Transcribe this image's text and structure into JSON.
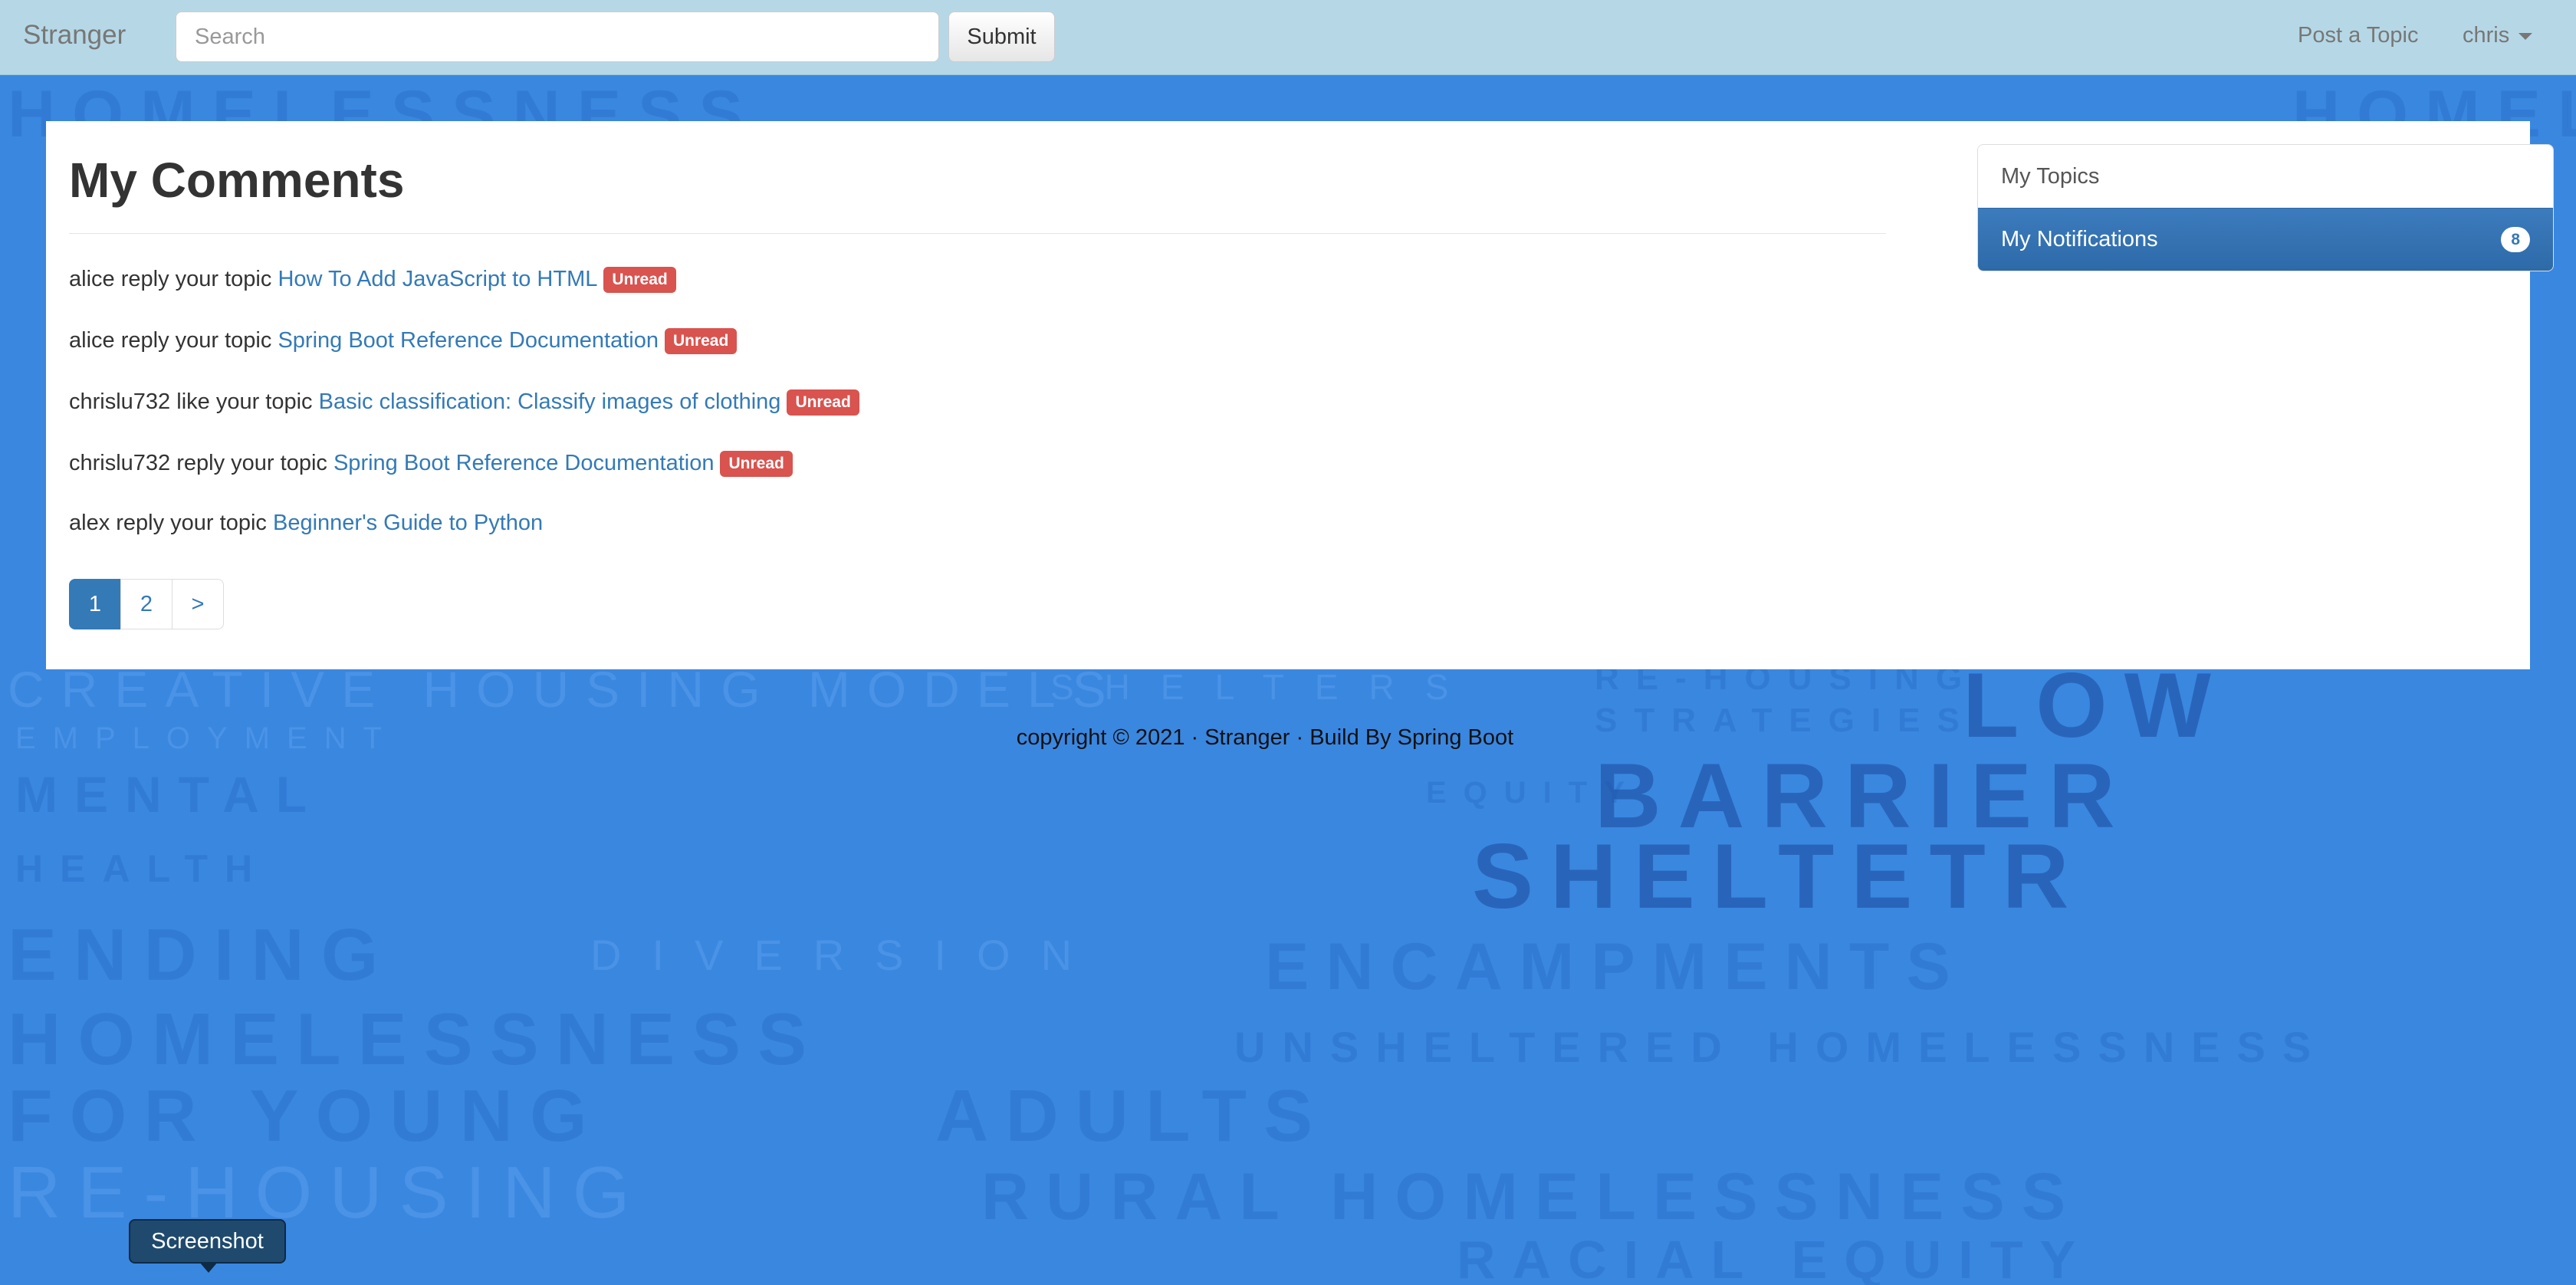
{
  "navbar": {
    "brand": "Stranger",
    "search_placeholder": "Search",
    "submit_label": "Submit",
    "post_topic_label": "Post a Topic",
    "user_label": "chris"
  },
  "main": {
    "title": "My Comments",
    "comments": [
      {
        "actor": "alice",
        "action": "reply your topic",
        "topic": "How To Add JavaScript to HTML",
        "badge": "Unread"
      },
      {
        "actor": "alice",
        "action": "reply your topic",
        "topic": "Spring Boot Reference Documentation",
        "badge": "Unread"
      },
      {
        "actor": "chrislu732",
        "action": "like your topic",
        "topic": "Basic classification: Classify images of clothing",
        "badge": "Unread"
      },
      {
        "actor": "chrislu732",
        "action": "reply your topic",
        "topic": "Spring Boot Reference Documentation",
        "badge": "Unread"
      },
      {
        "actor": "alex",
        "action": "reply your topic",
        "topic": "Beginner's Guide to Python",
        "badge": ""
      }
    ],
    "pagination": [
      "1",
      "2",
      ">"
    ]
  },
  "sidebar": {
    "items": [
      {
        "label": "My Topics",
        "badge": ""
      },
      {
        "label": "My Notifications",
        "badge": "8"
      }
    ]
  },
  "footer": {
    "text": "copyright © 2021 · Stranger · Build By Spring Boot"
  },
  "tooltip": {
    "label": "Screenshot"
  },
  "background_words": [
    "HOMELESSNESS",
    "CREATIVE HOUSING MODELS",
    "SHELTERS",
    "RE-HOUSING",
    "STRATEGIES",
    "LOW",
    "EMPLOYMENT",
    "BARRIER",
    "EQUITY",
    "MENTAL",
    "HEALTH",
    "SHELTETR",
    "ENDING",
    "DIVERSION",
    "ENCAMPMENTS",
    "UNSHELTERED HOMELESSNESS",
    "FOR YOUNG",
    "ADULTS",
    "RURAL HOMELESSNESS",
    "RACIAL EQUITY"
  ],
  "colors": {
    "navbar": "#b6d8e6",
    "page_background": "#3a87e0",
    "link": "#337ab7",
    "unread_badge": "#d9534f",
    "active_item": "#337ab7"
  }
}
